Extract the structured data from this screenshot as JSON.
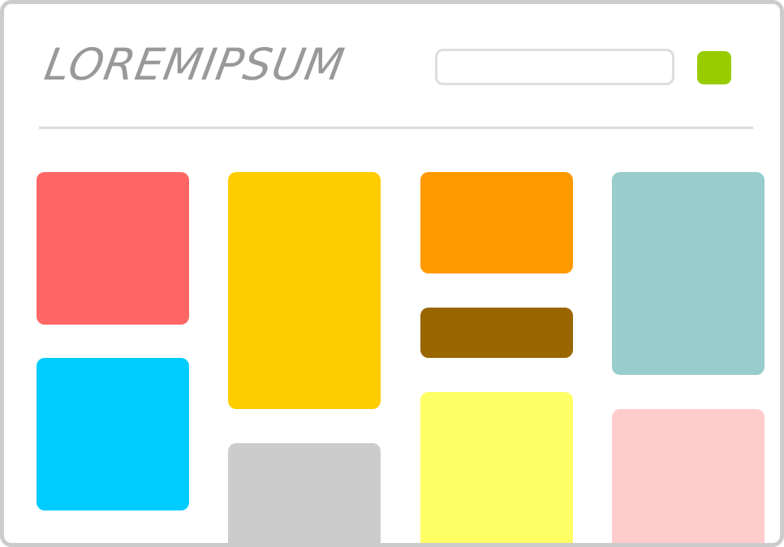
{
  "header": {
    "logo_text": "LOREMIPSUM",
    "search_placeholder": "",
    "search_value": "",
    "action_button_color": "#99cc00"
  },
  "colors": {
    "frame_border": "#cccccc",
    "divider": "#dddddd",
    "logo_text": "#999999"
  },
  "tiles": [
    {
      "id": "tile-red",
      "color": "#ff6666"
    },
    {
      "id": "tile-cyan",
      "color": "#00ccff"
    },
    {
      "id": "tile-yellow",
      "color": "#ffcc00"
    },
    {
      "id": "tile-gray",
      "color": "#cccccc"
    },
    {
      "id": "tile-orange",
      "color": "#ff9900"
    },
    {
      "id": "tile-brown",
      "color": "#996600"
    },
    {
      "id": "tile-light-yellow",
      "color": "#ffff66"
    },
    {
      "id": "tile-teal",
      "color": "#99cccc"
    },
    {
      "id": "tile-pink",
      "color": "#ffcccc"
    }
  ]
}
